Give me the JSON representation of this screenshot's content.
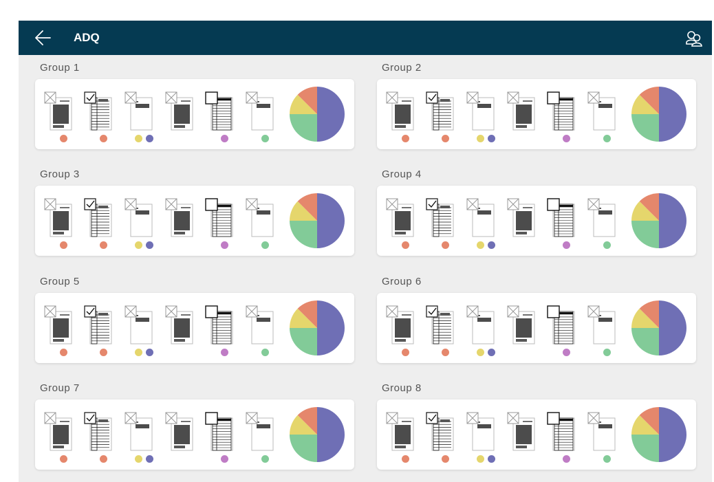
{
  "header": {
    "title": "ADQ",
    "back_icon": "arrow-left-icon",
    "menu_icon": "people-icon",
    "bg_color": "#053a52"
  },
  "groups": [
    {
      "title": "Group 1"
    },
    {
      "title": "Group 2"
    },
    {
      "title": "Group 3"
    },
    {
      "title": "Group 4"
    },
    {
      "title": "Group 5"
    },
    {
      "title": "Group 6"
    },
    {
      "title": "Group 7"
    },
    {
      "title": "Group 8"
    }
  ],
  "documents": [
    {
      "type": "text-page",
      "icon": "image-placeholder-icon",
      "dots": [
        "#e5876c"
      ]
    },
    {
      "type": "checklist-table",
      "icon": "checkbox-checked-icon",
      "dots": [
        "#e5876c"
      ]
    },
    {
      "type": "sparse-page",
      "icon": "image-placeholder-icon",
      "dots": [
        "#e5d66c",
        "#6f6fb5"
      ]
    },
    {
      "type": "text-page",
      "icon": "image-placeholder-icon",
      "dots": []
    },
    {
      "type": "table-page",
      "icon": "checkbox-empty-icon",
      "dots": [
        "#bf7cc5"
      ]
    },
    {
      "type": "sparse-page",
      "icon": "image-placeholder-icon",
      "dots": [
        "#82cb98"
      ]
    }
  ],
  "pie_colors": {
    "purple": "#6f6fb5",
    "green": "#82cb98",
    "yellow": "#e5d66c",
    "orange": "#e5876c"
  },
  "pie_shares": {
    "purple": 0.5,
    "green": 0.25,
    "yellow": 0.125,
    "orange": 0.125
  }
}
